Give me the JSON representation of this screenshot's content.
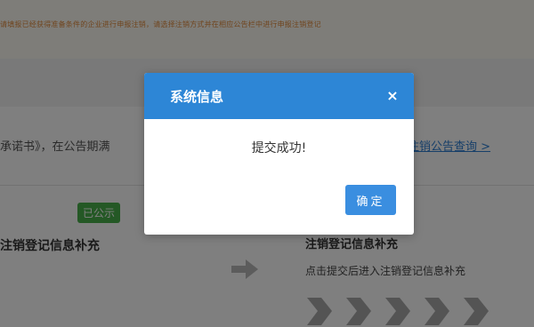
{
  "background": {
    "notice": "请填报已经获得准备条件的企业进行申报注销，请选择注销方式并在相应公告栏中进行申报注销登记",
    "promise_text": "承诺书》，在公告期满",
    "promise_link": "注销公告查询 >",
    "badge": "已公示",
    "left_title": "注销登记信息补充",
    "right_title": "注销登记信息补充",
    "right_desc": "点击提交后进入注销登记信息补充"
  },
  "modal": {
    "title": "系统信息",
    "close_label": "×",
    "message": "提交成功!",
    "ok_label": "确定"
  },
  "colors": {
    "header_blue": "#2d86d6",
    "button_blue": "#3a8ee0",
    "badge_green": "#49b04a",
    "notice_orange": "#e08a3c",
    "link_blue": "#2e7fd3"
  },
  "icons": {
    "close": "close-icon",
    "arrow": "arrow-right-icon",
    "chevrons": "chevron-right-icon"
  }
}
